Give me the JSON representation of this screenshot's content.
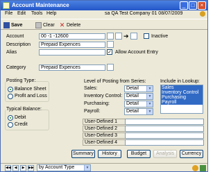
{
  "window": {
    "title": "Account Maintenance"
  },
  "menu": {
    "file": "File",
    "edit": "Edit",
    "tools": "Tools",
    "help": "Help",
    "company": "sa  QA Test Company 01  08/07/2009"
  },
  "toolbar": {
    "save": "Save",
    "clear": "Clear",
    "delete": "Delete"
  },
  "form": {
    "account_label": "Account",
    "account_value": "00 -1 -12600",
    "description_label": "Description",
    "description_value": "Prepaid Expences",
    "alias_label": "Alias",
    "alias_value": "",
    "inactive_label": "Inactive",
    "allow_entry_label": "Allow Account Entry",
    "category_label": "Category",
    "category_value": "Prepaid Expences"
  },
  "posting_type": {
    "title": "Posting Type:",
    "balance_sheet": "Balance Sheet",
    "profit_loss": "Profit and Loss",
    "selected": "Balance Sheet"
  },
  "typical_balance": {
    "title": "Typical Balance:",
    "debit": "Debit",
    "credit": "Credit",
    "selected": "Debit"
  },
  "level_posting": {
    "title": "Level of Posting from Series:",
    "rows": [
      {
        "label": "Sales:",
        "value": "Detail"
      },
      {
        "label": "Inventory Control:",
        "value": "Detail"
      },
      {
        "label": "Purchasing:",
        "value": "Detail"
      },
      {
        "label": "Payroll:",
        "value": "Detail"
      }
    ]
  },
  "lookup": {
    "title": "Include in Lookup:",
    "items": [
      "Sales",
      "Inventory Control",
      "Purchasing",
      "Payroll"
    ]
  },
  "user_defined": [
    "User-Defined 1",
    "User-Defined 2",
    "User-Defined 3",
    "User-Defined 4"
  ],
  "buttons": {
    "summary": "Summary",
    "history": "History",
    "budget": "Budget",
    "analysis": "Analysis",
    "currency": "Currency"
  },
  "status": {
    "sort": "by Account Type"
  },
  "colors": {
    "title_bar": "#2456c8",
    "selection": "#316ac5",
    "window_bg": "#ece9d8"
  }
}
